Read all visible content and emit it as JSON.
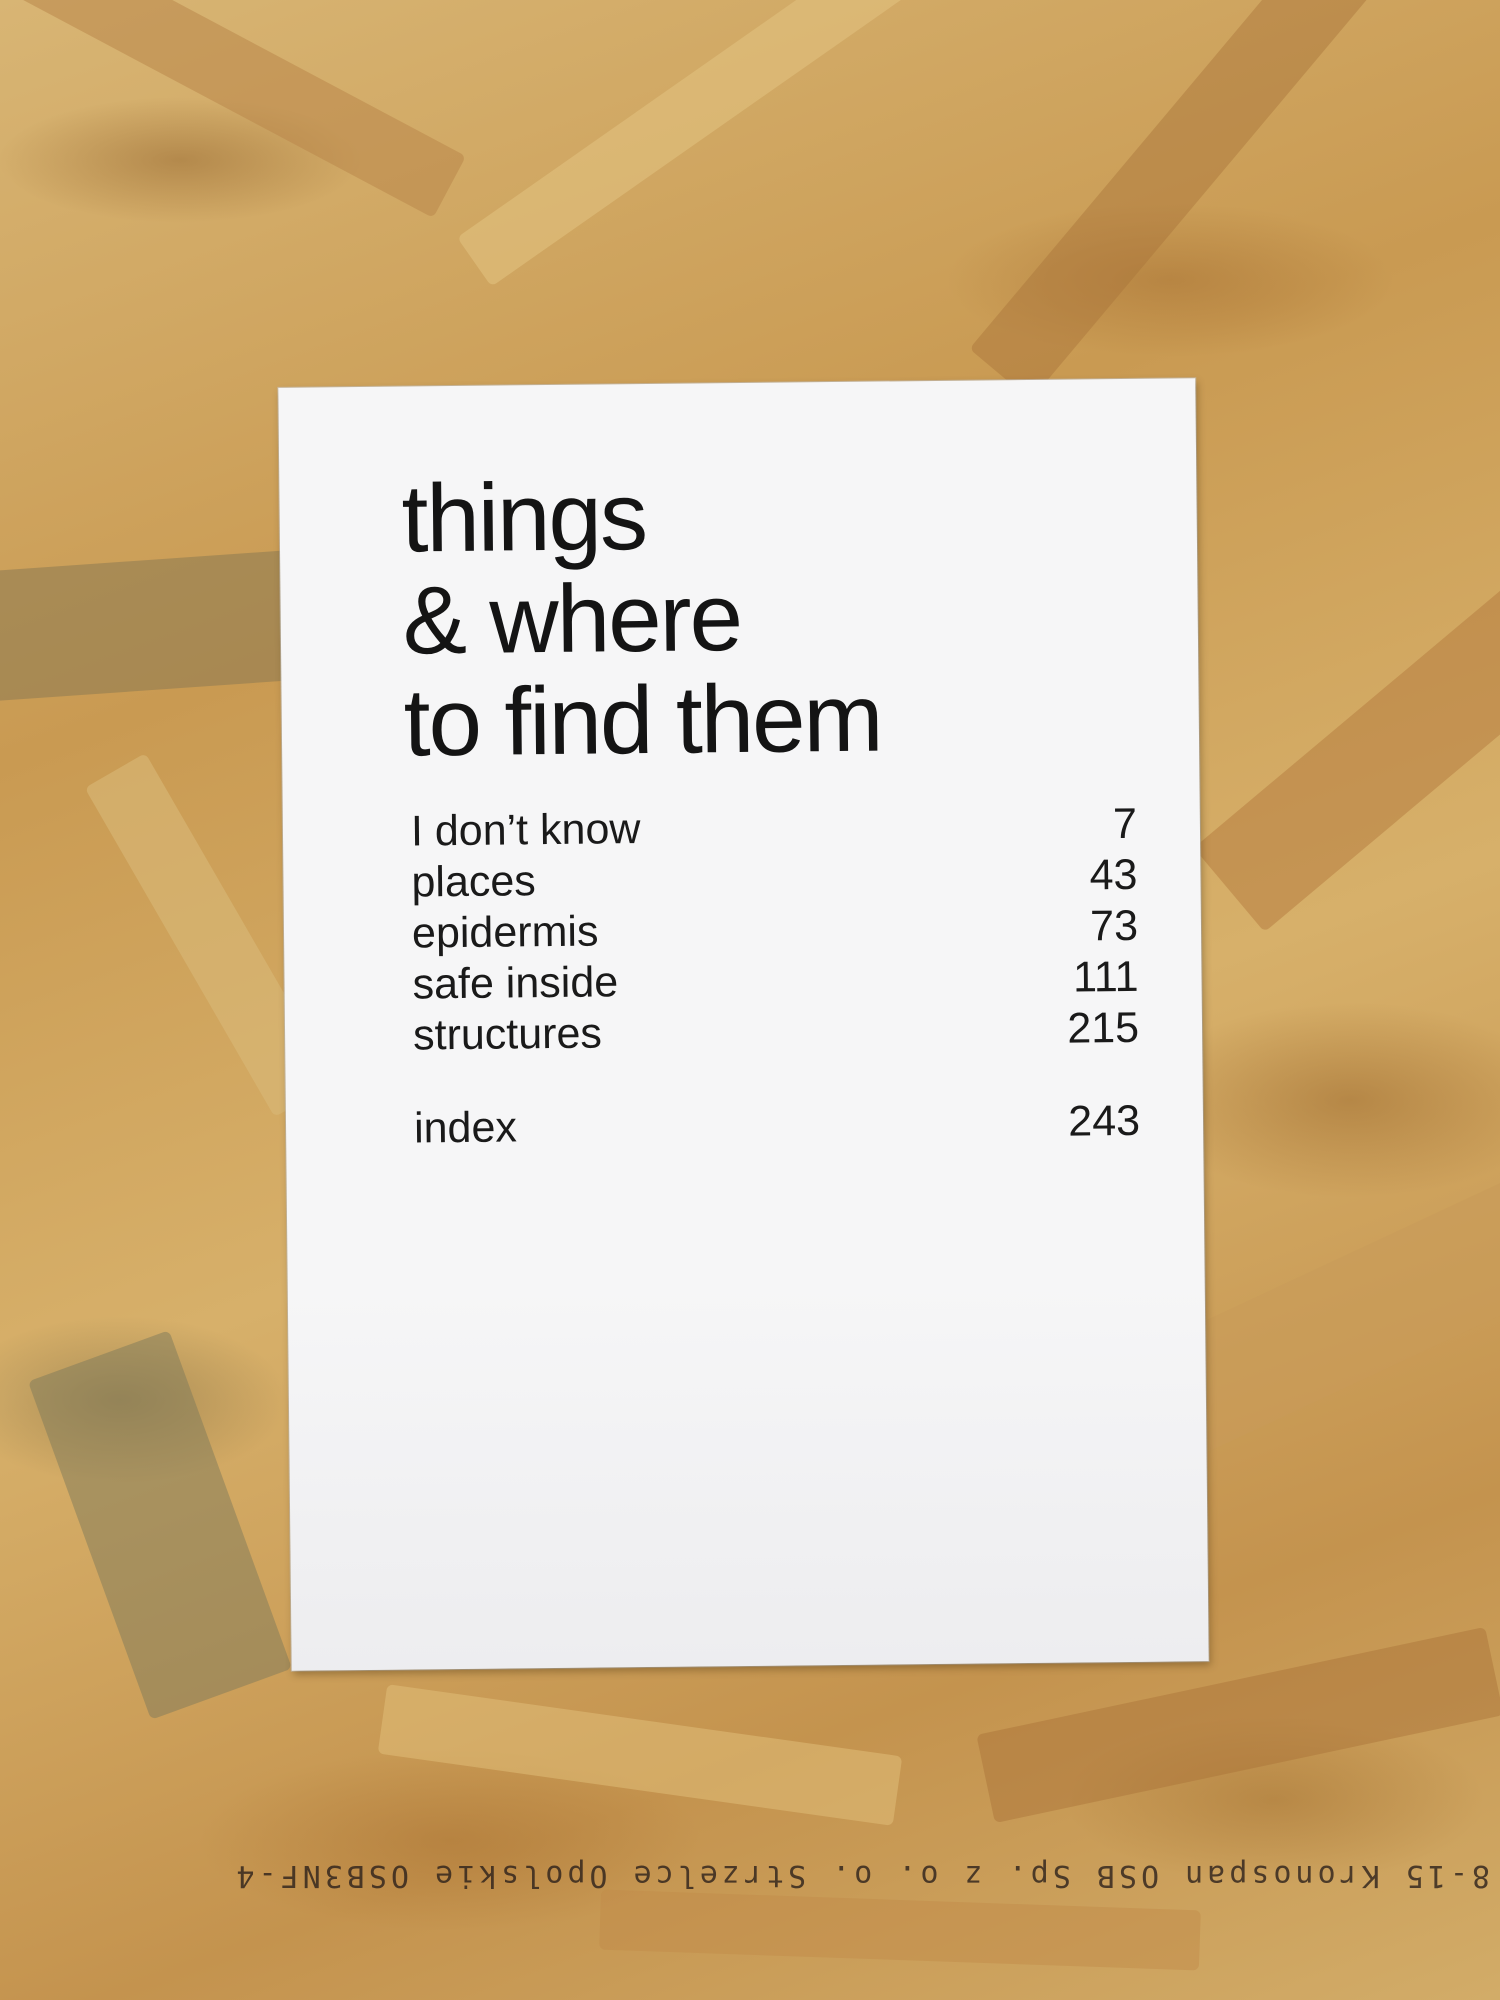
{
  "card": {
    "title_lines": [
      "things",
      "& where",
      "to find them"
    ],
    "toc": [
      {
        "label": "I don’t know",
        "page": "7"
      },
      {
        "label": "places",
        "page": "43"
      },
      {
        "label": "epidermis",
        "page": "73"
      },
      {
        "label": "safe inside",
        "page": "111"
      },
      {
        "label": "structures",
        "page": "215"
      },
      {
        "label": "index",
        "page": "243"
      }
    ]
  },
  "board_stamp": "8-15 Kronospan OSB Sp. z o. o. Strzelce Opolskie OSB3NF-4"
}
